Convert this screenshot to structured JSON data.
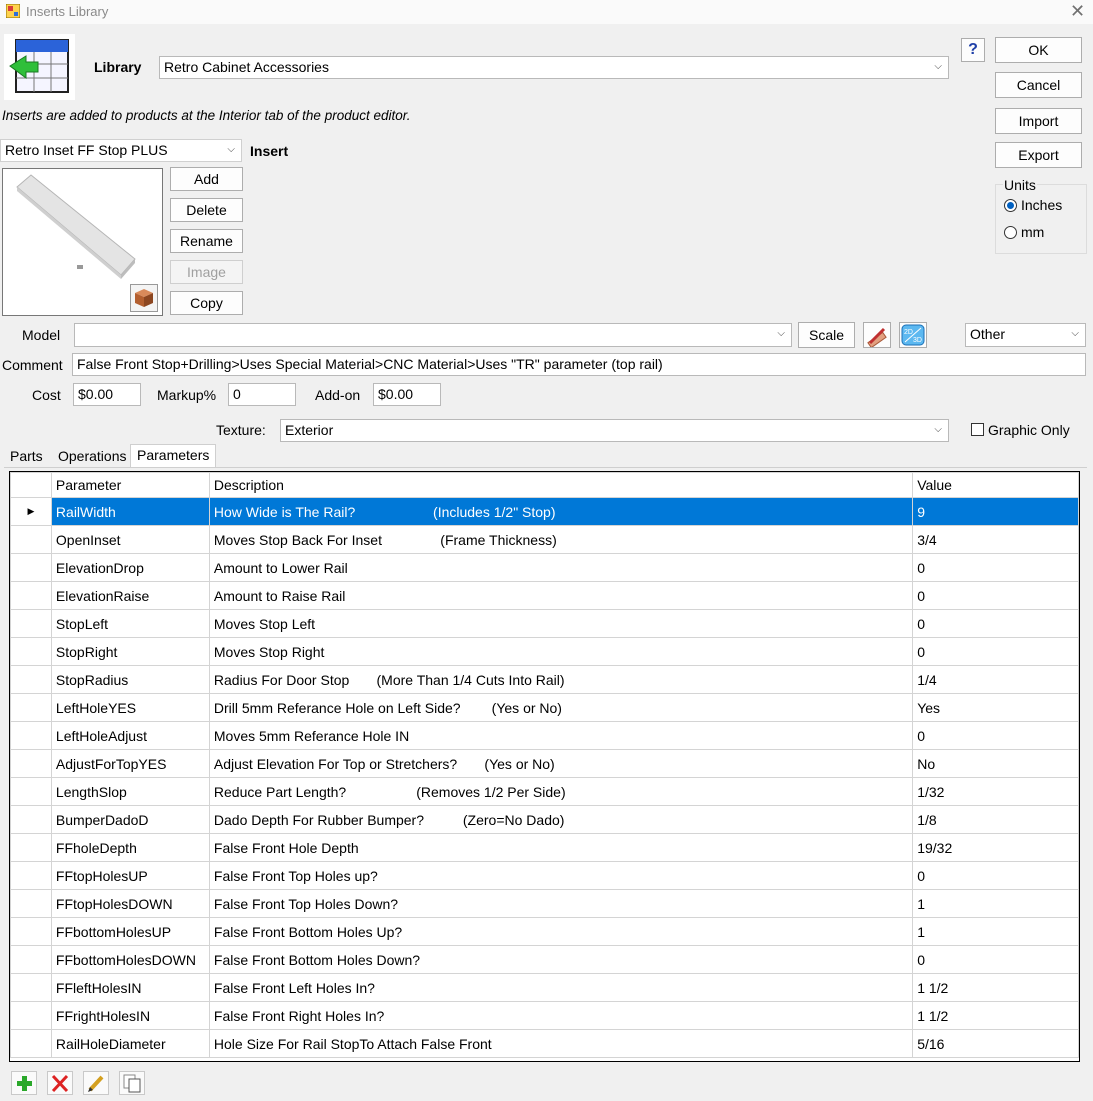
{
  "window": {
    "title": "Inserts Library"
  },
  "library": {
    "label": "Library",
    "value": "Retro Cabinet Accessories"
  },
  "info_text": "Inserts are added to products at the Interior tab of the product editor.",
  "right_buttons": {
    "ok": "OK",
    "cancel": "Cancel",
    "import": "Import",
    "export": "Export"
  },
  "units": {
    "label": "Units",
    "options": [
      "Inches",
      "mm"
    ],
    "selected": "Inches"
  },
  "insert": {
    "selected": "Retro Inset FF Stop PLUS",
    "label": "Insert",
    "buttons": {
      "add": "Add",
      "delete": "Delete",
      "rename": "Rename",
      "image": "Image",
      "copy": "Copy"
    }
  },
  "model": {
    "label": "Model",
    "value": "",
    "scale_label": "Scale",
    "category": "Other"
  },
  "comment": {
    "label": "Comment",
    "value": "False Front Stop+Drilling>Uses Special Material>CNC Material>Uses \"TR\" parameter (top rail)"
  },
  "pricing": {
    "cost_label": "Cost",
    "cost": "$0.00",
    "markup_label": "Markup%",
    "markup": "0",
    "addon_label": "Add-on",
    "addon": "$0.00"
  },
  "texture": {
    "label": "Texture:",
    "value": "Exterior",
    "graphic_only_label": "Graphic Only",
    "graphic_only": false
  },
  "tabs": [
    "Parts",
    "Operations",
    "Parameters"
  ],
  "active_tab": "Parameters",
  "grid": {
    "columns": [
      "Parameter",
      "Description",
      "Value"
    ],
    "rows": [
      {
        "parameter": "RailWidth",
        "description": "How Wide is The Rail?                    (Includes 1/2\" Stop)",
        "value": "9"
      },
      {
        "parameter": "OpenInset",
        "description": "Moves Stop Back For Inset               (Frame Thickness)",
        "value": "3/4"
      },
      {
        "parameter": "ElevationDrop",
        "description": "Amount to Lower Rail",
        "value": "0"
      },
      {
        "parameter": "ElevationRaise",
        "description": "Amount to Raise Rail",
        "value": "0"
      },
      {
        "parameter": "StopLeft",
        "description": "Moves Stop Left",
        "value": "0"
      },
      {
        "parameter": "StopRight",
        "description": "Moves Stop Right",
        "value": "0"
      },
      {
        "parameter": "StopRadius",
        "description": "Radius For Door Stop       (More Than 1/4 Cuts Into Rail)",
        "value": "1/4"
      },
      {
        "parameter": "LeftHoleYES",
        "description": "Drill 5mm Referance Hole on Left Side?        (Yes or No)",
        "value": "Yes"
      },
      {
        "parameter": "LeftHoleAdjust",
        "description": "Moves 5mm Referance Hole IN",
        "value": "0"
      },
      {
        "parameter": "AdjustForTopYES",
        "description": "Adjust Elevation For Top or Stretchers?       (Yes or No)",
        "value": "No"
      },
      {
        "parameter": "LengthSlop",
        "description": "Reduce Part Length?                  (Removes 1/2 Per Side)",
        "value": "1/32"
      },
      {
        "parameter": "BumperDadoD",
        "description": "Dado Depth For Rubber Bumper?          (Zero=No Dado)",
        "value": "1/8"
      },
      {
        "parameter": "FFholeDepth",
        "description": "False Front Hole Depth",
        "value": "19/32"
      },
      {
        "parameter": "FFtopHolesUP",
        "description": "False Front Top Holes up?",
        "value": "0"
      },
      {
        "parameter": "FFtopHolesDOWN",
        "description": "False Front Top Holes Down?",
        "value": "1"
      },
      {
        "parameter": "FFbottomHolesUP",
        "description": "False Front Bottom Holes Up?",
        "value": "1"
      },
      {
        "parameter": "FFbottomHolesDOWN",
        "description": "False Front Bottom Holes Down?",
        "value": "0"
      },
      {
        "parameter": "FFleftHolesIN",
        "description": "False Front Left Holes In?",
        "value": "1 1/2"
      },
      {
        "parameter": "FFrightHolesIN",
        "description": "False Front Right Holes In?",
        "value": "1 1/2"
      },
      {
        "parameter": "RailHoleDiameter",
        "description": "Hole Size For Rail StopTo Attach False Front",
        "value": "5/16"
      }
    ],
    "selected_row": 0
  },
  "toolbar_icons": [
    "add-icon",
    "delete-icon",
    "edit-icon",
    "copy-icon"
  ],
  "colors": {
    "selection": "#0078d7",
    "window_bg": "#f0f0f0"
  }
}
